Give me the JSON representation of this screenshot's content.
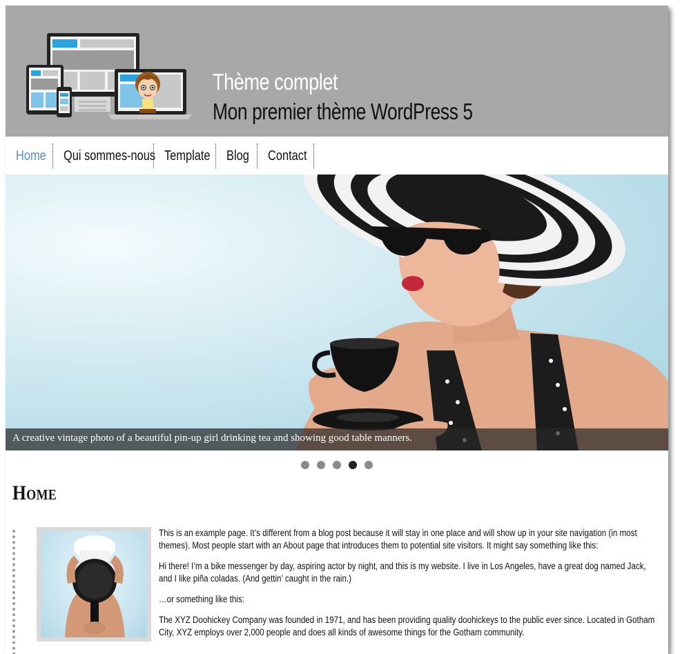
{
  "header": {
    "site_title": "Thème complet",
    "site_description": "Mon premier thème WordPress 5"
  },
  "nav": {
    "items": [
      {
        "label": "Home",
        "active": true
      },
      {
        "label": "Qui sommes-nous",
        "active": false
      },
      {
        "label": "Template",
        "active": false
      },
      {
        "label": "Blog",
        "active": false
      },
      {
        "label": "Contact",
        "active": false
      }
    ]
  },
  "slider": {
    "caption": "A creative vintage photo of a beautiful pin-up girl drinking tea and showing good table manners.",
    "slide_count": 5,
    "active_slide": 4
  },
  "content": {
    "heading": "Home",
    "paragraphs": [
      "This is an example page. It’s different from a blog post because it will stay in one place and will show up in your site navigation (in most themes). Most people start with an About page that introduces them to potential site visitors. It might say something like this:",
      "Hi there! I’m a bike messenger by day, aspiring actor by night, and this is my website. I live in Los Angeles, have a great dog named Jack, and I like piña coladas. (And gettin’ caught in the rain.)",
      "…or something like this:",
      "The XYZ Doohickey Company was founded in 1971, and has been providing quality doohickeys to the public ever since. Located in Gotham City, XYZ employs over 2,000 people and does all kinds of awesome things for the Gotham community."
    ]
  },
  "colors": {
    "header_bg": "#a8a8a8",
    "nav_active": "#5b8ec9",
    "text": "#111111"
  }
}
